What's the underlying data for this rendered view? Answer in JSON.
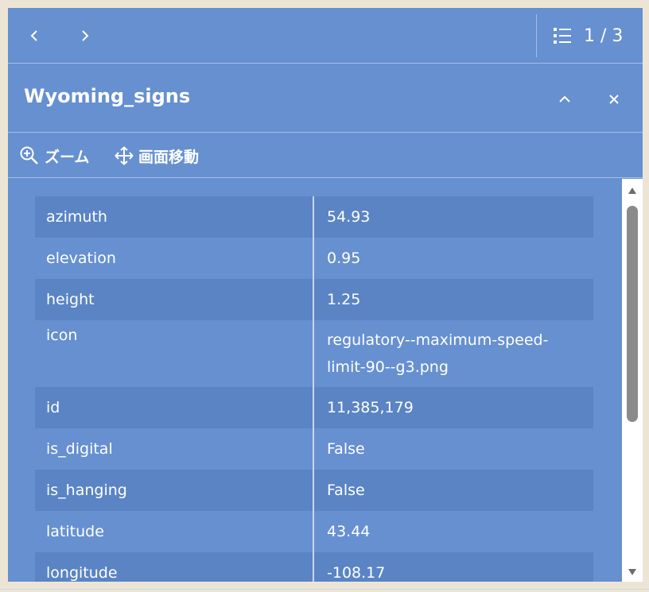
{
  "nav": {
    "prev_icon": "chevron-left-icon",
    "next_icon": "chevron-right-icon",
    "list_icon": "list-icon",
    "feature_count": "1 / 3"
  },
  "header": {
    "title": "Wyoming_signs",
    "collapse_icon": "chevron-up-icon",
    "close_icon": "close-icon"
  },
  "actions": {
    "zoom_label": "ズーム",
    "zoom_icon": "zoom-in-icon",
    "pan_label": "画面移動",
    "pan_icon": "move-icon"
  },
  "attributes": [
    {
      "key": "azimuth",
      "value": "54.93"
    },
    {
      "key": "elevation",
      "value": "0.95"
    },
    {
      "key": "height",
      "value": "1.25"
    },
    {
      "key": "icon",
      "value": "regulatory--maximum-speed-limit-90--g3.png"
    },
    {
      "key": "id",
      "value": "11,385,179"
    },
    {
      "key": "is_digital",
      "value": "False"
    },
    {
      "key": "is_hanging",
      "value": "False"
    },
    {
      "key": "latitude",
      "value": "43.44"
    },
    {
      "key": "longitude",
      "value": "-108.17"
    }
  ],
  "colors": {
    "panel": "#6690d0",
    "row_alt": "#5a84c4",
    "divider": "#a6bee3",
    "text": "#ffffff",
    "map_bg": "#ece5d5"
  }
}
